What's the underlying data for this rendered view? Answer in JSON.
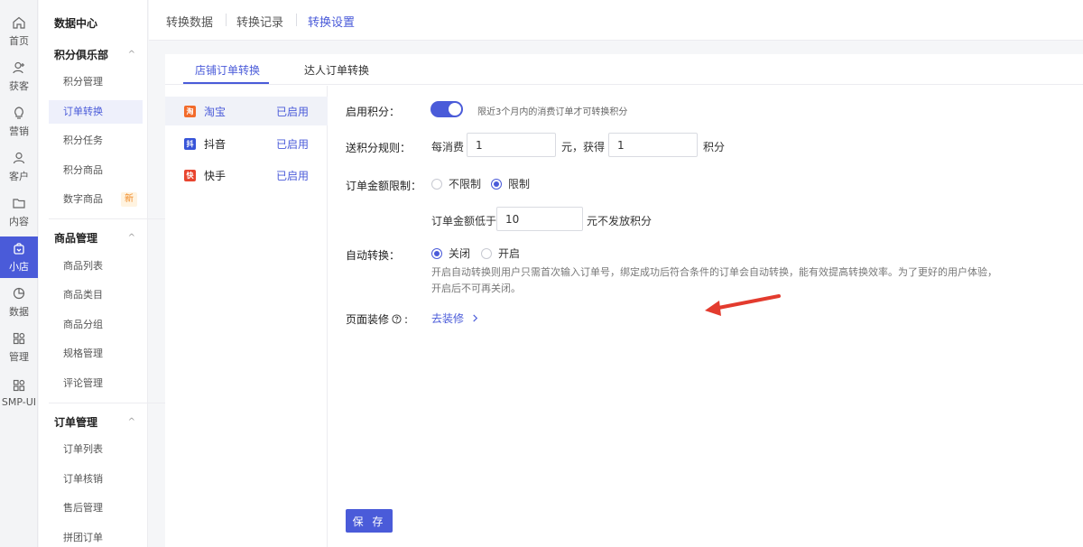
{
  "rail": [
    {
      "label": "首页",
      "icon": "home-icon"
    },
    {
      "label": "获客",
      "icon": "user-plus-icon"
    },
    {
      "label": "营销",
      "icon": "lightbulb-icon"
    },
    {
      "label": "客户",
      "icon": "user-icon"
    },
    {
      "label": "内容",
      "icon": "folder-icon"
    },
    {
      "label": "小店",
      "icon": "shop-bag-icon",
      "active": true
    },
    {
      "label": "数据",
      "icon": "pie-chart-icon"
    },
    {
      "label": "管理",
      "icon": "grid-icon"
    },
    {
      "label": "SMP-UI",
      "icon": "grid-icon"
    }
  ],
  "menu": {
    "top": "数据中心",
    "groups": [
      {
        "title": "积分俱乐部",
        "items": [
          "积分管理",
          "订单转换",
          "积分任务",
          "积分商品",
          "数字商品"
        ]
      },
      {
        "title": "商品管理",
        "items": [
          "商品列表",
          "商品类目",
          "商品分组",
          "规格管理",
          "评论管理"
        ]
      },
      {
        "title": "订单管理",
        "items": [
          "订单列表",
          "订单核销",
          "售后管理",
          "拼团订单"
        ]
      }
    ],
    "new_badge": "新",
    "chevron": "^"
  },
  "header": {
    "tabs": [
      "转换数据",
      "转换记录",
      "转换设置"
    ]
  },
  "subtabs": [
    "店铺订单转换",
    "达人订单转换"
  ],
  "platforms": [
    {
      "name": "淘宝",
      "status": "已启用",
      "icon_text": "淘",
      "color": "#f26b2b"
    },
    {
      "name": "抖音",
      "status": "已启用",
      "icon_text": "抖",
      "color": "#3754d8"
    },
    {
      "name": "快手",
      "status": "已启用",
      "icon_text": "快",
      "color": "#e8452f"
    }
  ],
  "form": {
    "enable_label": "启用积分：",
    "enable_hint": "限近3个月内的消费订单才可转换积分",
    "rule_label": "送积分规则：",
    "rule_prefix": "每消费",
    "rule_amount": "1",
    "rule_middle": "元，获得",
    "rule_points": "1",
    "rule_suffix": "积分",
    "limit_label": "订单金额限制：",
    "limit_opt_none": "不限制",
    "limit_opt_on": "限制",
    "min_prefix": "订单金额低于",
    "min_value": "10",
    "min_suffix": "元不发放积分",
    "auto_label": "自动转换：",
    "auto_off": "关闭",
    "auto_on": "开启",
    "auto_desc_1": "开启自动转换则用户只需首次输入订单号，绑定成功后符合条件的订单会自动转换，能有效提高转换效率。为了更好的用户体验，",
    "auto_desc_2": "开启后不可再关闭。",
    "decor_label": "页面装修",
    "decor_link": "去装修",
    "save": "保 存"
  },
  "colors": {
    "accent": "#4a5bd9",
    "arrow": "#e33b2e"
  }
}
